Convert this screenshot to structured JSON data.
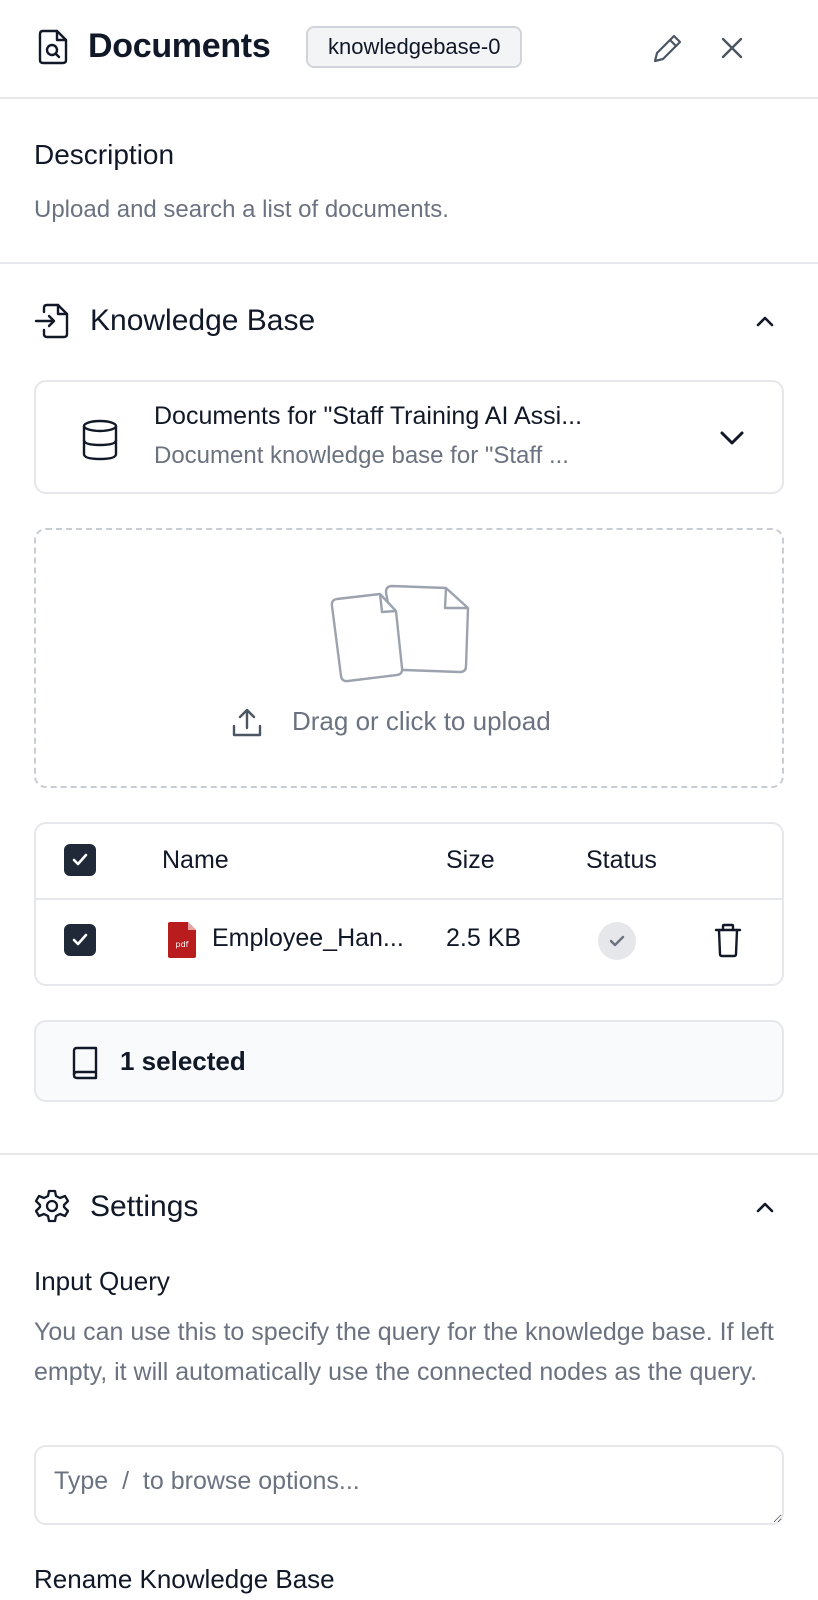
{
  "header": {
    "title": "Documents",
    "tag": "knowledgebase-0"
  },
  "description": {
    "heading": "Description",
    "text": "Upload and search a list of documents."
  },
  "knowledge_base": {
    "heading": "Knowledge Base",
    "selected_title": "Documents for \"Staff Training AI Assi...",
    "selected_subtitle": "Document knowledge base for \"Staff ...",
    "upload_text": "Drag or click to upload",
    "table": {
      "columns": [
        "Name",
        "Size",
        "Status"
      ],
      "rows": [
        {
          "name": "Employee_Han...",
          "size": "2.5 KB",
          "type": "pdf",
          "status": "done",
          "checked": true
        }
      ]
    },
    "selected_count": "1 selected"
  },
  "settings": {
    "heading": "Settings",
    "input_query_label": "Input Query",
    "input_query_help": "You can use this to specify the query for the knowledge base. If left empty, it will automatically use the connected nodes as the query.",
    "input_query_placeholder": "Type  /  to browse options...",
    "rename_label": "Rename Knowledge Base"
  },
  "colors": {
    "text": "#111827",
    "muted": "#6b7280",
    "border": "#e5e7eb",
    "checkbox": "#1f2937",
    "pdf": "#b91c1c"
  },
  "icons": [
    "document-search-icon",
    "pencil-icon",
    "close-icon",
    "import-icon",
    "chevron-up-icon",
    "database-icon",
    "chevron-down-icon",
    "files-icon",
    "upload-icon",
    "check-icon",
    "pdf-icon",
    "trash-icon",
    "book-icon",
    "gear-icon"
  ]
}
